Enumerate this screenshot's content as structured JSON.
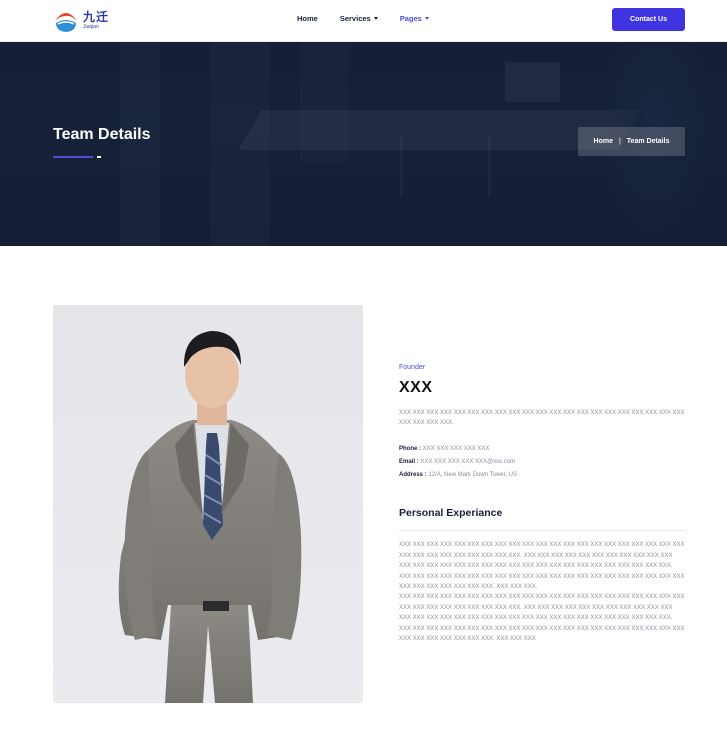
{
  "header": {
    "logo_cn": "九迁",
    "logo_en": "Jiuqian",
    "nav": [
      {
        "label": "Home",
        "has_caret": false
      },
      {
        "label": "Services",
        "has_caret": true
      },
      {
        "label": "Pages",
        "has_caret": true,
        "active": true
      }
    ],
    "contact_label": "Contact Us"
  },
  "banner": {
    "title": "Team Details",
    "breadcrumb": {
      "home": "Home",
      "current": "Team Details"
    }
  },
  "member": {
    "role": "Founder",
    "name": "XXX",
    "bio": "XXX XXX XXX XXX XXX XXX XXX XXX XXX XXX XXX XXX XXX XXX XXX XXX XXX XXX XXX XXX XXX XXX XXX XXX XXX.",
    "phone_label": "Phone :",
    "phone": "XXX XXX XXX XXX XXX",
    "email_label": "Email :",
    "email": "XXX XXX XXX XXX XXX@xxx.com",
    "address_label": "Address :",
    "address": "12/A, New Mark Down Tower, US"
  },
  "experience": {
    "title": "Personal Experiance",
    "para1": "XXX XXX XXX XXX XXX XXX XXX XXX XXX XXX XXX XXX XXX XXX XXX XXX XXX XXX XXX XXX XXX XXX XXX XXX XXX XXX XXX XXX XXX XXX. XXX XXX XXX XXX XXX XXX XXX XXX XXX XXX XXX XXX XXX XXX XXX XXX XXX XXX XXX XXX XXX XXX XXX XXX XXX XXX XXX XXX XXX XXX XXX. XXX XXX XXX XXX XXX XXX XXX XXX XXX XXX XXX XXX XXX XXX XXX XXX XXX XXX XXX XXX XXX XXX XXX XXX XXX XXX XXX XXX. XXX XXX XXX.",
    "para2": "XXX XXX XXX XXX XXX XXX XXX XXX XXX XXX XXX XXX XXX XXX XXX XXX XXX XXX XXX XXX XXX XXX XXX XXX XXX XXX XXX XXX XXX XXX. XXX XXX XXX XXX XXX XXX XXX XXX XXX XXX XXX XXX XXX XXX XXX XXX XXX XXX XXX XXX XXX XXX XXX XXX XXX XXX XXX XXX XXX XXX XXX. XXX XXX XXX XXX XXX XXX XXX XXX XXX XXX XXX XXX XXX XXX XXX XXX XXX XXX XXX XXX XXX XXX XXX XXX XXX XXX XXX XXX. XXX XXX XXX"
  },
  "colors": {
    "accent": "#3f34e0",
    "banner": "#1b2841",
    "text_dark": "#1a1f3b",
    "text_muted": "#8b8f9b"
  }
}
